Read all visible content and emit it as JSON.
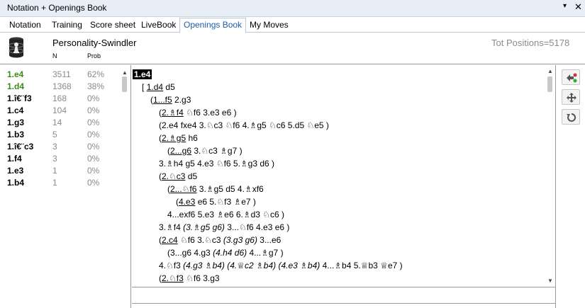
{
  "window": {
    "title": "Notation + Openings Book",
    "dropdown_icon": "▾",
    "close_icon": "✕"
  },
  "tabs": [
    {
      "label": "Notation"
    },
    {
      "label": "Training"
    },
    {
      "label": "Score sheet"
    },
    {
      "label": "LiveBook"
    },
    {
      "label": "Openings Book",
      "active": true
    },
    {
      "label": "My Moves"
    }
  ],
  "header": {
    "book_name": "Personality-Swindler",
    "col_n": "N",
    "col_prob": "Prob",
    "total_positions": "Tot Positions=5178"
  },
  "moves": [
    {
      "move": "1.e4",
      "n": "3511",
      "prob": "62%",
      "highlight": true
    },
    {
      "move": "1.d4",
      "n": "1368",
      "prob": "38%",
      "highlight": true
    },
    {
      "move": "1.î€¨f3",
      "n": "168",
      "prob": "0%"
    },
    {
      "move": "1.c4",
      "n": "104",
      "prob": "0%"
    },
    {
      "move": "1.g3",
      "n": "14",
      "prob": "0%"
    },
    {
      "move": "1.b3",
      "n": "5",
      "prob": "0%"
    },
    {
      "move": "1.î€¨c3",
      "n": "3",
      "prob": "0%"
    },
    {
      "move": "1.f4",
      "n": "3",
      "prob": "0%"
    },
    {
      "move": "1.e3",
      "n": "1",
      "prob": "0%"
    },
    {
      "move": "1.b4",
      "n": "1",
      "prob": "0%"
    }
  ],
  "notation": {
    "line01": "1.e4",
    "line02_a": "[",
    "line02_b": "1.d4",
    "line02_c": "d5",
    "line03_a": "(",
    "line03_b": "1...f5",
    "line03_c": "2.g3",
    "line04_a": "(",
    "line04_b": "2.♗f4",
    "line04_c": "♘f6  3.e3  e6 )",
    "line05_a": "(",
    "line05_b": "2.e4  fxe4  3.♘c3  ♘f6  4.♗g5  ♘c6  5.d5  ♘e5 )",
    "line06_a": "(",
    "line06_b": "2.♗g5",
    "line06_c": "h6",
    "line07_a": "(",
    "line07_b": "2...g6",
    "line07_c": "3.♘c3  ♗g7 )",
    "line08": "3.♗h4  g5  4.e3  ♘f6  5.♗g3  d6 )",
    "line09_a": "(",
    "line09_b": "2.♘c3",
    "line09_c": "d5",
    "line10_a": "(",
    "line10_b": "2...♘f6",
    "line10_c": "3.♗g5  d5  4.♗xf6",
    "line11_a": "(",
    "line11_b": "4.e3",
    "line11_c": "e6  5.♘f3  ♗e7 )",
    "line12": "4...exf6  5.e3  ♗e6  6.♗d3  ♘c6 )",
    "line13_a": "3.♗f4",
    "line13_b": "(3.♗g5  g6)",
    "line13_c": "3...♘f6  4.e3  e6 )",
    "line14_a": "(",
    "line14_b": "2.c4",
    "line14_c": "♘f6  3.♘c3",
    "line14_d": "(3.g3  g6)",
    "line14_e": "3...e6",
    "line15_a": "(",
    "line15_b": "3...g6",
    "line15_c": "4.g3",
    "line15_d": "(4.h4  d6)",
    "line15_e": "4...♗g7 )",
    "line16_a": "4.♘f3",
    "line16_b": "(4.g3  ♗b4)",
    "line16_c": "(4.♕c2  ♗b4)",
    "line16_d": "(4.e3  ♗b4)",
    "line16_e": "4...♗b4  5.♕b3  ♕e7 )",
    "line17_a": "(",
    "line17_b": "2.♘f3",
    "line17_c": "♘f6  3.g3"
  },
  "toolbar": [
    {
      "name": "merge-move-icon"
    },
    {
      "name": "move-arrows-icon"
    },
    {
      "name": "rotate-icon"
    }
  ]
}
